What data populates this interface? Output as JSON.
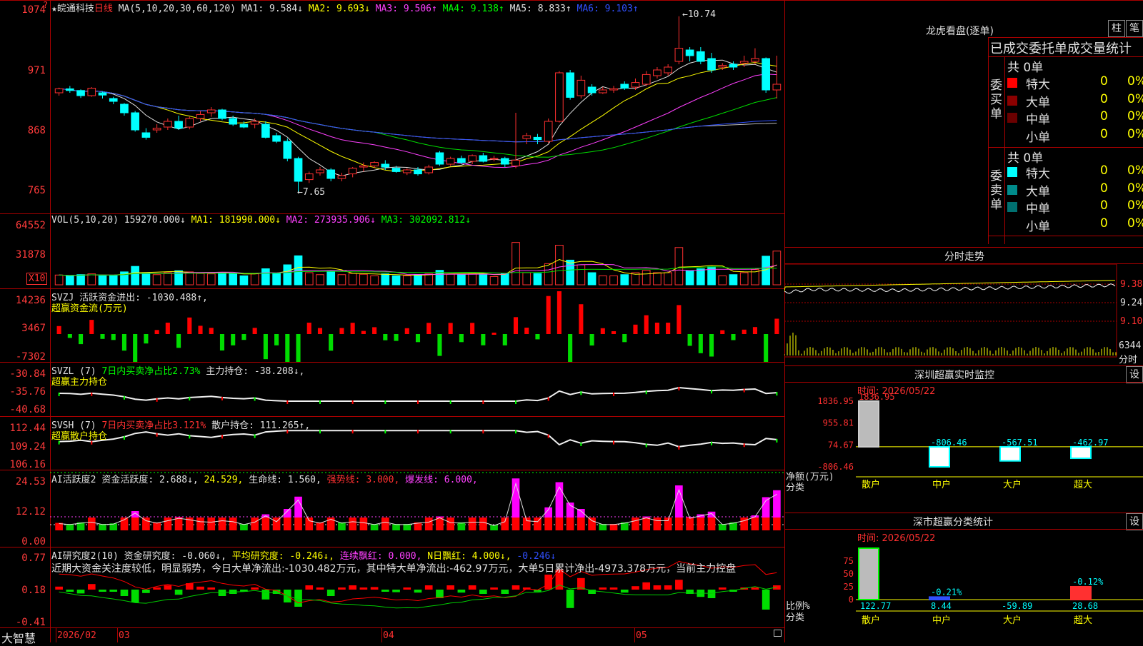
{
  "main": {
    "title_star": "★",
    "stock_name": "皖通科技",
    "period": "日线",
    "ma_header": "MA(5,10,20,30,60,120)",
    "ma1": "MA1: 9.584↓",
    "ma2": "MA2: 9.693↓",
    "ma3": "MA3: 9.506↑",
    "ma4": "MA4: 9.138↑",
    "ma5": "MA5: 8.833↑",
    "ma6": "MA6: 9.103↑",
    "y_ticks": [
      "1074",
      "971",
      "868",
      "765"
    ],
    "high_note": "10.74",
    "low_note": "7.65"
  },
  "vol": {
    "header": "VOL(5,10,20)",
    "value": "159270.000↓",
    "ma1": "MA1: 181990.000↓",
    "ma2": "MA2: 273935.906↓",
    "ma3": "MA3: 302092.812↓",
    "y_ticks": [
      "64552",
      "31878"
    ],
    "unit": "X10"
  },
  "svzj": {
    "line1": "SVZJ  活跃资金进出: -1030.488↑,",
    "line2": "超赢资金流(万元)",
    "y_ticks": [
      "14236",
      "3467",
      "-7302"
    ]
  },
  "svzl": {
    "prefix": "SVZL (7)",
    "ratio": "7日内买卖净占比2.73%",
    "main": "主力持仓: -38.208↓,",
    "line2": "超赢主力持仓",
    "y_ticks": [
      "-30.84",
      "-35.76",
      "-40.68"
    ]
  },
  "svsh": {
    "prefix": "SVSH (7)",
    "ratio": "7日内买卖净占比3.121%",
    "retail": "散户持仓: 111.265↑,",
    "line2": "超赢散户持仓",
    "y_ticks": [
      "112.44",
      "109.24",
      "106.16"
    ]
  },
  "ai_active": {
    "title": "AI活跃度2",
    "fund": "资金活跃度: 2.688↓,",
    "v2": "24.529,",
    "life": "生命线: 1.560,",
    "strong": "强势线: 3.000,",
    "burst": "爆发线: 6.000,",
    "y_ticks": [
      "24.53",
      "12.12",
      "0.00"
    ]
  },
  "ai_research": {
    "title": "AI研究度2(10)",
    "fund": "资金研究度: -0.060↓,",
    "avg": "平均研究度: -0.246↓,",
    "red_seq": "连续飘红: 0.000,",
    "n_red": "N日飘红: 4.000↓,",
    "last": "-0.246↓",
    "comment": "近期大资金关注度较低，明显弱势，今日大单净流出:-1030.482万元，其中特大单净流出:-462.97万元，大单5日累计净出-4973.378万元，当前主力控盘",
    "y_ticks": [
      "0.77",
      "0.18",
      "-0.41"
    ]
  },
  "xaxis": {
    "brand": "大智慧",
    "labels": [
      "2026/02",
      "03",
      "04",
      "05"
    ]
  },
  "longhu": {
    "title": "龙虎看盘(逐单)",
    "btn_bar": "柱",
    "btn_tick": "笔",
    "tabs": "已成交委托单成交量统计",
    "buy_side": "委买单",
    "sell_side": "委卖单",
    "buy_total": "共 0单",
    "sell_total": "共 0单",
    "buy_rows": [
      {
        "name": "特大",
        "count": "0",
        "pct": "0%",
        "color": "#ff0000"
      },
      {
        "name": "大单",
        "count": "0",
        "pct": "0%",
        "color": "#8b0000"
      },
      {
        "name": "中单",
        "count": "0",
        "pct": "0%",
        "color": "#6a0000"
      },
      {
        "name": "小单",
        "count": "0",
        "pct": "0%",
        "color": "#000000"
      }
    ],
    "sell_rows": [
      {
        "name": "特大",
        "count": "0",
        "pct": "0%",
        "color": "#00ffff"
      },
      {
        "name": "大单",
        "count": "0",
        "pct": "0%",
        "color": "#008b8b"
      },
      {
        "name": "中单",
        "count": "0",
        "pct": "0%",
        "color": "#007070"
      },
      {
        "name": "小单",
        "count": "0",
        "pct": "0%",
        "color": "#000000"
      }
    ]
  },
  "intraday": {
    "title": "分时走势",
    "y_ticks": [
      "9.38",
      "9.24",
      "9.10"
    ],
    "vol_label": "6344",
    "unit": "分时"
  },
  "sz_monitor": {
    "title": "深圳超赢实时监控",
    "btn": "设",
    "time": "时间: 2026/05/22",
    "top_value": "1836.95",
    "y_ticks": [
      "1836.95",
      "955.81",
      "74.67",
      "-806.46"
    ],
    "ylabel": "净额(万元)",
    "xlabel": "分类",
    "categories": [
      "散户",
      "中户",
      "大户",
      "超大"
    ],
    "values": [
      1836.95,
      -806.46,
      -567.51,
      -462.97
    ],
    "value_labels": [
      "",
      "-806.46",
      "-567.51",
      "-462.97"
    ]
  },
  "sz_class": {
    "title": "深市超赢分类统计",
    "btn": "设",
    "time": "时间: 2026/05/22",
    "y_ticks": [
      "75",
      "50",
      "25",
      "0"
    ],
    "ylabel": "比例%",
    "xlabel": "分类",
    "categories": [
      "散户",
      "中户",
      "大户",
      "超大"
    ],
    "top_labels": [
      "",
      "-0.21%",
      "",
      "-0.12%"
    ],
    "bottom_values": [
      "122.77",
      "8.44",
      "-59.89",
      "28.68"
    ]
  },
  "chart_data": {
    "type": "candlestick",
    "title": "皖通科技 日线",
    "ylim": [
      7.4,
      10.9
    ],
    "candles": [
      [
        9.4,
        9.47,
        9.35,
        9.49
      ],
      [
        9.47,
        9.44,
        9.4,
        9.52
      ],
      [
        9.44,
        9.35,
        9.31,
        9.46
      ],
      [
        9.35,
        9.48,
        9.33,
        9.5
      ],
      [
        9.4,
        9.36,
        9.3,
        9.42
      ],
      [
        9.3,
        9.25,
        9.2,
        9.33
      ],
      [
        9.2,
        9.05,
        9.0,
        9.22
      ],
      [
        9.05,
        8.75,
        8.72,
        9.08
      ],
      [
        8.7,
        8.62,
        8.58,
        8.78
      ],
      [
        8.75,
        8.78,
        8.7,
        8.85
      ],
      [
        8.8,
        8.9,
        8.75,
        8.95
      ],
      [
        8.9,
        8.78,
        8.75,
        9.0
      ],
      [
        8.8,
        8.95,
        8.76,
        8.98
      ],
      [
        8.95,
        9.02,
        8.9,
        9.08
      ],
      [
        9.05,
        9.1,
        8.98,
        9.15
      ],
      [
        9.1,
        8.95,
        8.92,
        9.12
      ],
      [
        8.95,
        8.85,
        8.82,
        9.0
      ],
      [
        8.85,
        8.8,
        8.78,
        8.9
      ],
      [
        8.85,
        8.9,
        8.78,
        8.95
      ],
      [
        8.85,
        8.62,
        8.6,
        8.9
      ],
      [
        8.65,
        8.55,
        8.52,
        8.7
      ],
      [
        8.55,
        8.25,
        8.2,
        8.6
      ],
      [
        8.25,
        7.85,
        7.65,
        8.28
      ],
      [
        7.88,
        7.98,
        7.82,
        8.02
      ],
      [
        8.0,
        8.05,
        7.95,
        8.1
      ],
      [
        8.05,
        7.9,
        7.85,
        8.08
      ],
      [
        7.9,
        7.95,
        7.85,
        8.0
      ],
      [
        7.98,
        8.08,
        7.92,
        8.1
      ],
      [
        8.1,
        8.12,
        8.02,
        8.18
      ],
      [
        8.12,
        8.18,
        8.08,
        8.2
      ],
      [
        8.15,
        8.1,
        8.05,
        8.22
      ],
      [
        8.08,
        8.02,
        8.0,
        8.12
      ],
      [
        8.0,
        8.05,
        7.96,
        8.08
      ],
      [
        8.05,
        7.98,
        7.95,
        8.1
      ],
      [
        8.0,
        8.1,
        7.97,
        8.14
      ],
      [
        8.35,
        8.15,
        8.12,
        8.38
      ],
      [
        8.15,
        8.25,
        8.12,
        8.28
      ],
      [
        8.25,
        8.18,
        8.15,
        8.3
      ],
      [
        8.2,
        8.3,
        8.15,
        8.32
      ],
      [
        8.3,
        8.2,
        8.18,
        8.35
      ],
      [
        8.25,
        8.25,
        8.2,
        8.3
      ],
      [
        8.25,
        8.15,
        8.1,
        8.28
      ],
      [
        8.12,
        8.22,
        8.08,
        9.05
      ],
      [
        8.6,
        8.65,
        8.5,
        8.7
      ],
      [
        8.62,
        8.58,
        8.5,
        8.68
      ],
      [
        8.55,
        8.9,
        8.52,
        8.95
      ],
      [
        8.9,
        9.75,
        8.88,
        9.78
      ],
      [
        9.75,
        9.32,
        9.28,
        9.8
      ],
      [
        9.35,
        9.62,
        9.3,
        9.7
      ],
      [
        9.5,
        9.4,
        9.35,
        9.55
      ],
      [
        9.4,
        9.45,
        9.38,
        9.5
      ],
      [
        9.45,
        9.47,
        9.4,
        9.52
      ],
      [
        9.55,
        9.48,
        9.45,
        9.6
      ],
      [
        9.5,
        9.58,
        9.45,
        9.65
      ],
      [
        9.55,
        9.72,
        9.52,
        9.78
      ],
      [
        9.7,
        9.8,
        9.65,
        9.85
      ],
      [
        9.75,
        9.85,
        9.7,
        9.9
      ],
      [
        9.95,
        10.18,
        9.9,
        10.74
      ],
      [
        10.15,
        10.05,
        9.95,
        10.2
      ],
      [
        10.12,
        9.95,
        9.9,
        10.2
      ],
      [
        10.0,
        9.8,
        9.75,
        10.1
      ],
      [
        9.85,
        9.88,
        9.8,
        9.92
      ],
      [
        9.9,
        9.85,
        9.8,
        9.95
      ],
      [
        9.92,
        9.95,
        9.85,
        10.05
      ],
      [
        9.95,
        10.0,
        9.9,
        10.18
      ],
      [
        10.0,
        9.45,
        9.4,
        10.02
      ],
      [
        9.45,
        9.55,
        9.3,
        10.05
      ]
    ]
  }
}
